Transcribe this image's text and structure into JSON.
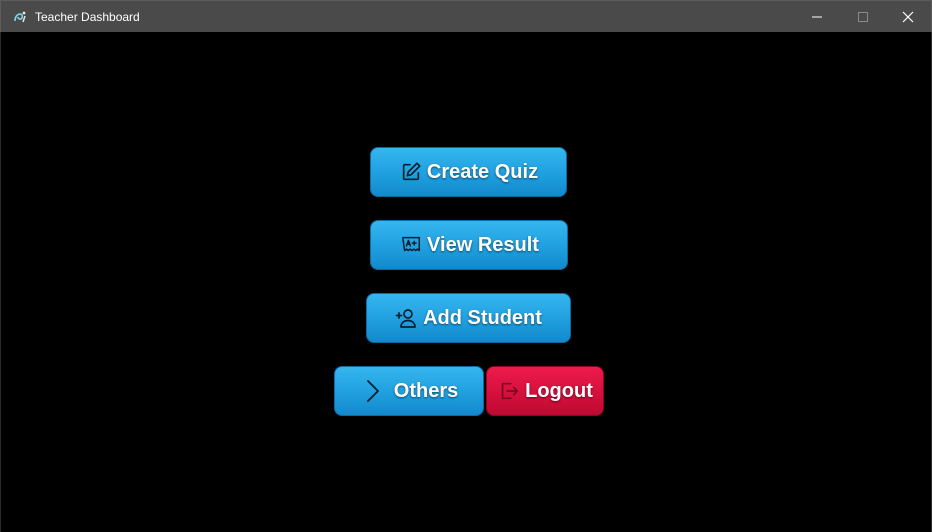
{
  "window": {
    "title": "Teacher Dashboard",
    "controls": [
      "minimize",
      "maximize",
      "close"
    ]
  },
  "buttons": {
    "create_quiz": {
      "label": "Create Quiz",
      "icon": "edit-icon"
    },
    "view_result": {
      "label": "View Result",
      "icon": "grade-a-plus-icon"
    },
    "add_student": {
      "label": "Add Student",
      "icon": "add-user-icon"
    },
    "others": {
      "label": "Others",
      "icon": "chevron-right-icon"
    },
    "logout": {
      "label": "Logout",
      "icon": "logout-icon"
    }
  },
  "colors": {
    "background": "#000000",
    "titlebar": "#4a4a4a",
    "primary_button": "#1f9fdf",
    "danger_button": "#d5103c",
    "text": "#ffffff",
    "icon_stroke": "#0b1e2b"
  }
}
